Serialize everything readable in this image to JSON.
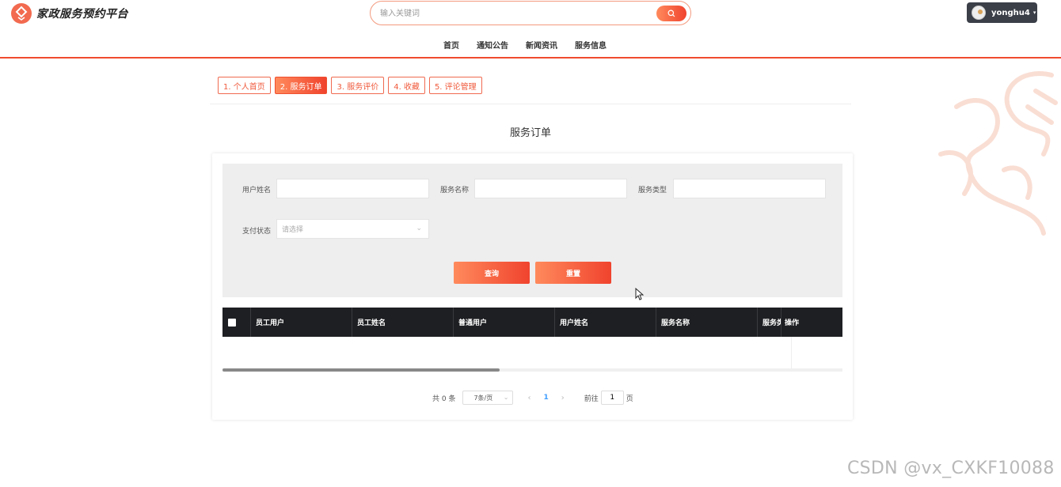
{
  "header": {
    "logo_text": "家政服务预约平台",
    "search_placeholder": "输入关键词",
    "username": "yonghu4",
    "nav": [
      "首页",
      "通知公告",
      "新闻资讯",
      "服务信息"
    ]
  },
  "tabs": [
    {
      "label": "1. 个人首页",
      "active": false
    },
    {
      "label": "2. 服务订单",
      "active": true
    },
    {
      "label": "3. 服务评价",
      "active": false
    },
    {
      "label": "4. 收藏",
      "active": false
    },
    {
      "label": "5. 评论管理",
      "active": false
    }
  ],
  "page_title": "服务订单",
  "filters": {
    "user_name_label": "用户姓名",
    "service_name_label": "服务名称",
    "service_type_label": "服务类型",
    "pay_status_label": "支付状态",
    "pay_status_placeholder": "请选择",
    "search_button": "查询",
    "reset_button": "重置"
  },
  "table": {
    "columns": [
      "员工用户",
      "员工姓名",
      "普通用户",
      "用户姓名",
      "服务名称",
      "服务类",
      "操作"
    ]
  },
  "pagination": {
    "total_label": "共 0 条",
    "page_size": "7条/页",
    "current_page": "1",
    "goto_label": "前往",
    "goto_value": "1",
    "page_suffix": "页"
  },
  "watermark": "CSDN @vx_CXKF10088",
  "colors": {
    "accent": "#f0432e",
    "accent_light": "#ff8a5c",
    "table_header": "#1e1f22"
  }
}
